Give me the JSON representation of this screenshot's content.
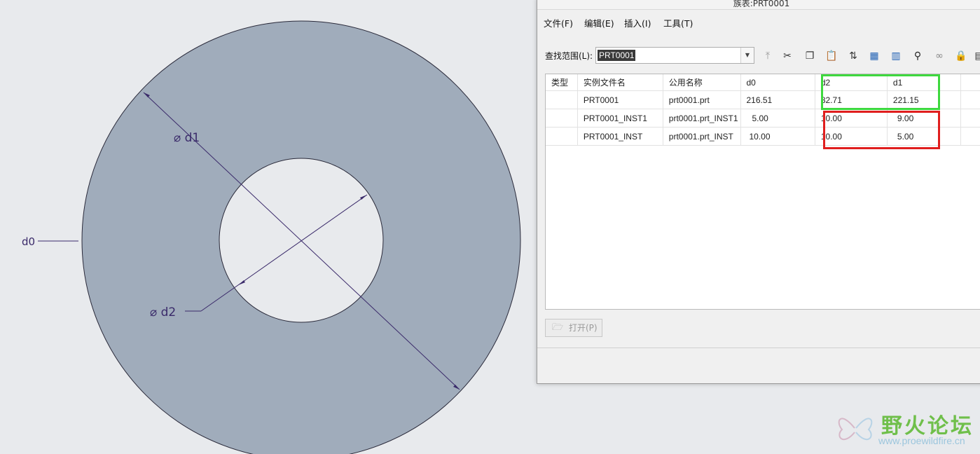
{
  "dialog": {
    "title": "族表:PRT0001",
    "menu": [
      "文件(F)",
      "编辑(E)",
      "插入(I)",
      "工具(T)"
    ],
    "scope_label": "查找范围(L):",
    "scope_value": "PRT0001",
    "toolbar_icons": [
      "insert-level-icon",
      "cut-icon",
      "copy-icon",
      "paste-icon",
      "sort-icon",
      "add-column-icon",
      "table-icon",
      "find-icon",
      "glasses-icon",
      "lock-icon"
    ],
    "table": {
      "columns": [
        "类型",
        "实例文件名",
        "公用名称",
        "d0",
        "d2",
        "d1"
      ],
      "rows": [
        [
          "",
          "PRT0001",
          "prt0001.prt",
          "216.51",
          "82.71",
          "221.15"
        ],
        [
          "",
          "PRT0001_INST1",
          "prt0001.prt_INST1",
          "5.00",
          "10.00",
          "9.00"
        ],
        [
          "",
          "PRT0001_INST",
          "prt0001.prt_INST",
          "10.00",
          "10.00",
          "5.00"
        ]
      ]
    },
    "open_button": "打开(P)"
  },
  "drawing": {
    "dim_d0": "d0",
    "dim_d1": "⌀ d1",
    "dim_d2": "⌀ d2",
    "part_color": "#a0acbb",
    "dim_color": "#3a2a6a"
  },
  "watermark": {
    "text": "野火论坛",
    "url": "www.proewildfire.cn"
  },
  "highlights": {
    "green": "#3ed83e",
    "red": "#e01e1e"
  }
}
